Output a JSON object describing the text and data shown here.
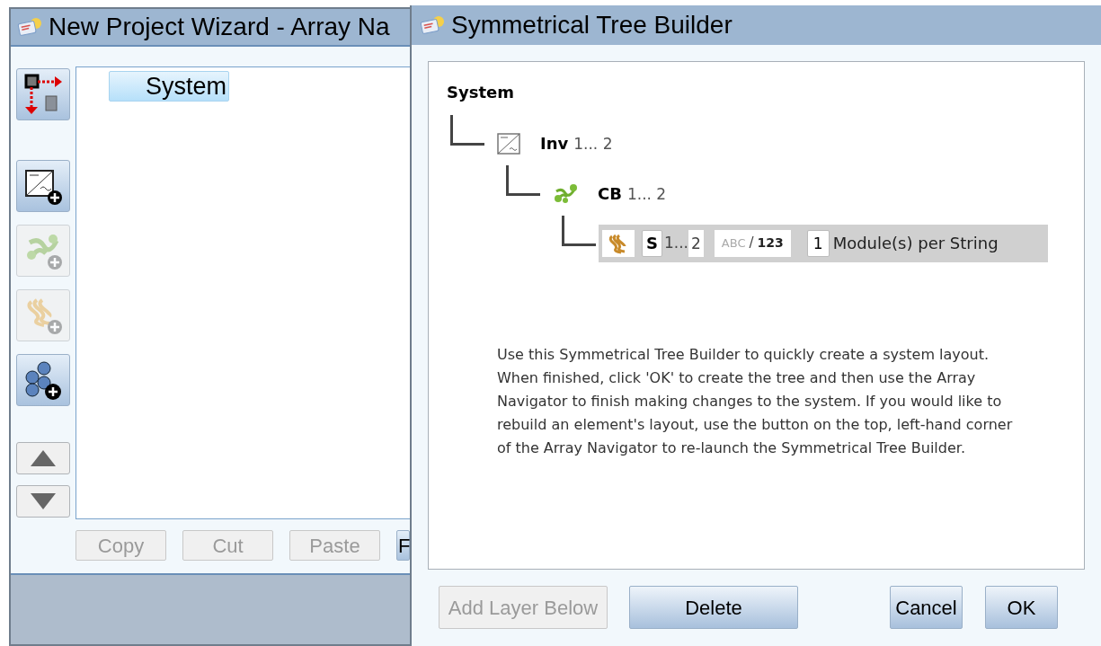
{
  "back_window": {
    "title": "New Project Wizard - Array Na",
    "toolbar": [
      {
        "kind": "rebuild",
        "disabled": false
      },
      {
        "kind": "inverter",
        "disabled": false
      },
      {
        "kind": "combiner",
        "disabled": true
      },
      {
        "kind": "string",
        "disabled": true
      },
      {
        "kind": "modules",
        "disabled": false
      },
      {
        "kind": "up",
        "disabled": false
      },
      {
        "kind": "down",
        "disabled": false
      }
    ],
    "tree": [
      {
        "label": "System",
        "selected": true
      }
    ],
    "buttons": [
      {
        "label": "Copy",
        "disabled": true
      },
      {
        "label": "Cut",
        "disabled": true
      },
      {
        "label": "Paste",
        "disabled": true
      },
      {
        "label": "F",
        "disabled": false
      }
    ]
  },
  "dialog": {
    "title": "Symmetrical Tree Builder",
    "tree": {
      "label": "System",
      "children": [
        {
          "kind": "inverter",
          "name": "Inv",
          "range": "1... 2",
          "children": [
            {
              "kind": "combiner",
              "name": "CB",
              "range": "1... 2",
              "children": [
                {
                  "kind": "string",
                  "name": "S",
                  "range_from": "1...",
                  "range_to": "2",
                  "naming_letters": "ABC",
                  "naming_separator": "/",
                  "naming_digits": "123",
                  "modules": "1",
                  "modules_label": "Module(s) per String",
                  "selected": true
                }
              ]
            }
          ]
        }
      ]
    },
    "instructions": "Use this Symmetrical Tree Builder to quickly create a system layout. When finished, click 'OK' to create the tree and then use the Array Navigator to finish making changes to the system. If you would like to rebuild an element's layout, use the button on the top, left-hand corner of the Array Navigator to re-launch the Symmetrical Tree Builder.",
    "buttons": [
      {
        "label": "Add Layer Below",
        "disabled": true
      },
      {
        "label": "Delete",
        "disabled": false
      },
      {
        "label": "Cancel",
        "disabled": false
      },
      {
        "label": "OK",
        "disabled": false
      }
    ]
  }
}
